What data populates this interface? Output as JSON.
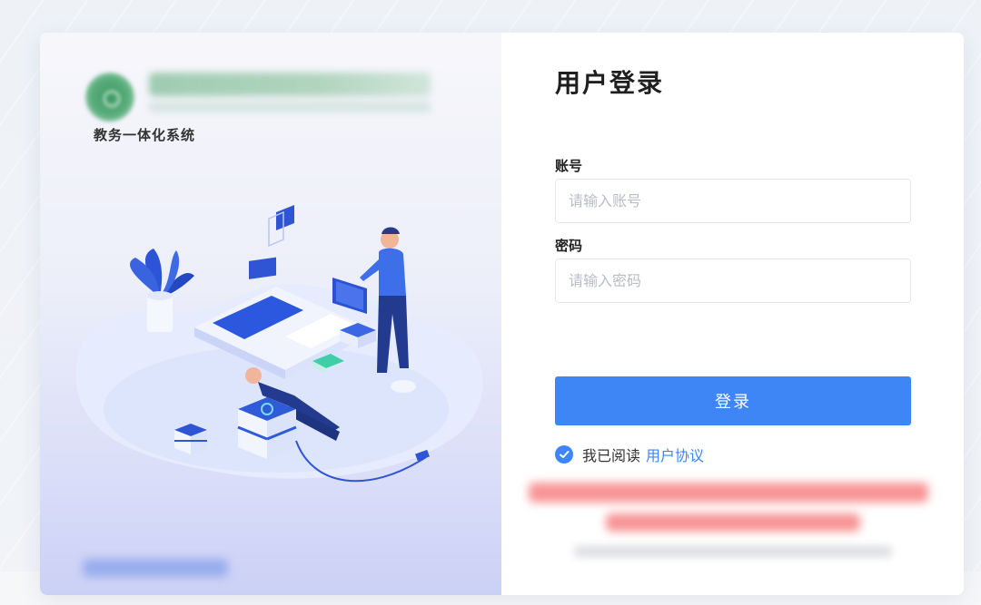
{
  "brand": {
    "system_name": "教务一体化系统"
  },
  "login": {
    "title": "用户登录",
    "account_label": "账号",
    "account_placeholder": "请输入账号",
    "account_value": "",
    "password_label": "密码",
    "password_placeholder": "请输入密码",
    "password_value": "",
    "submit_label": "登录",
    "agree_text": "我已阅读",
    "agree_link": "用户协议",
    "agree_checked": true
  },
  "colors": {
    "accent": "#3e86f5",
    "text": "#222222",
    "placeholder": "#b8bcc4"
  },
  "icons": {
    "check": "check-circle-icon",
    "illustration": "workspace-illustration"
  }
}
